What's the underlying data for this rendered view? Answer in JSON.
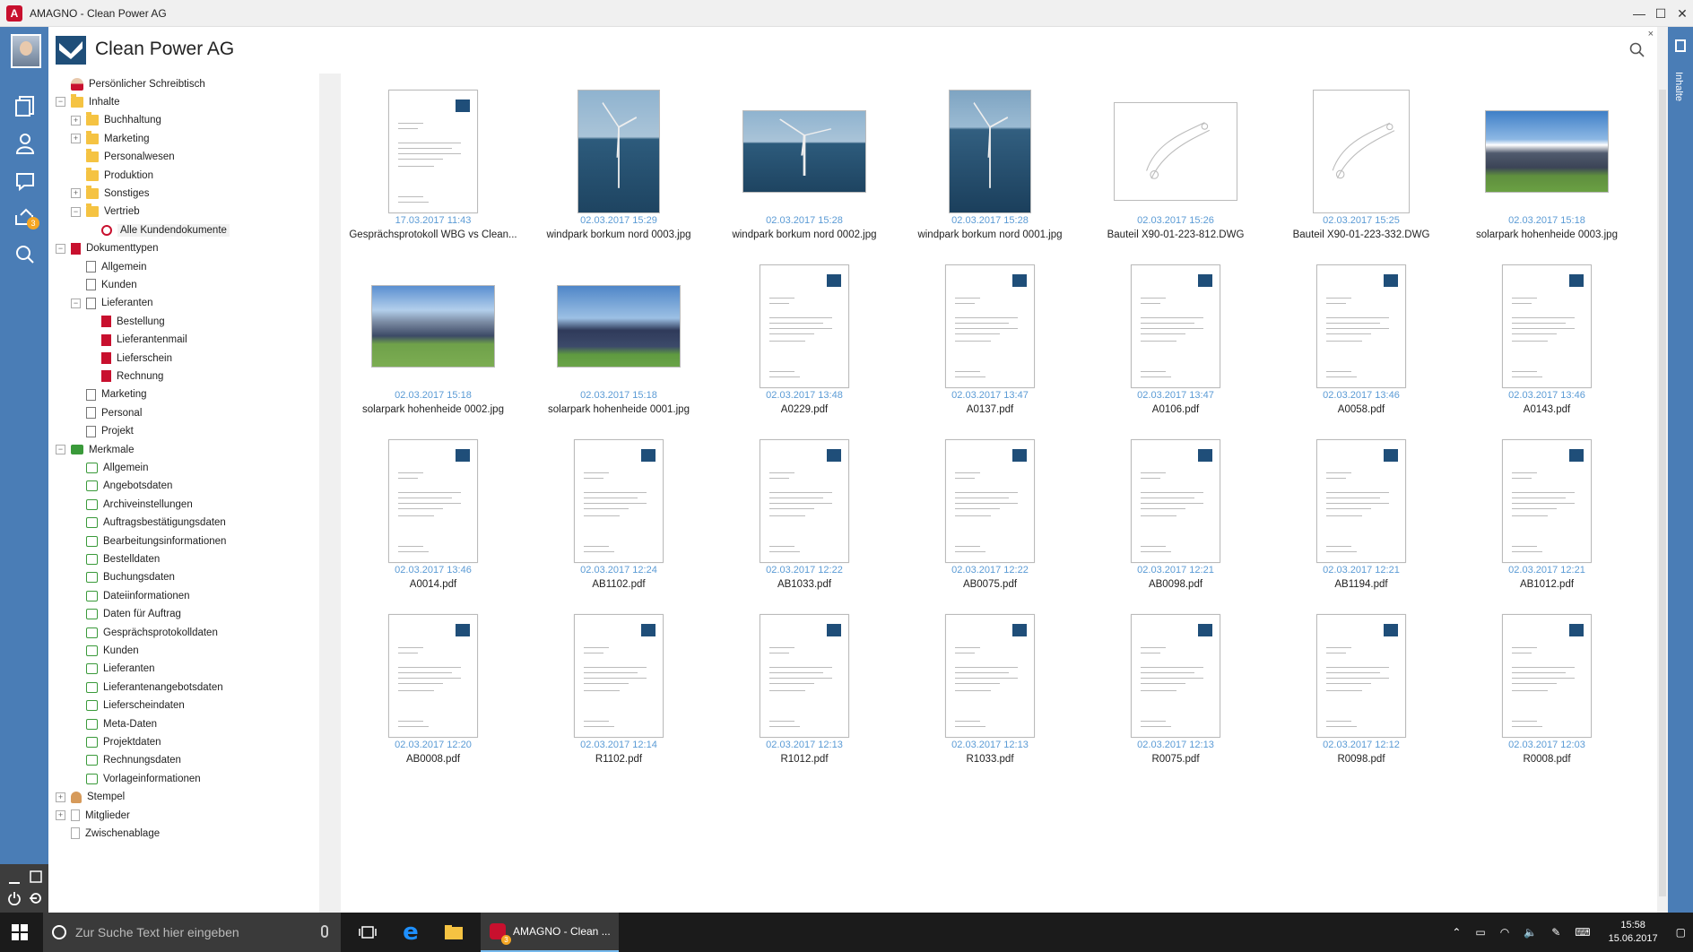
{
  "window": {
    "title": "AMAGNO - Clean Power AG",
    "app_icon_letter": "A"
  },
  "header": {
    "company": "Clean Power AG",
    "close_symbol": "×"
  },
  "rail": {
    "notification_count": "3"
  },
  "right_panel": {
    "label": "Inhalte"
  },
  "tree": [
    {
      "label": "Persönlicher Schreibtisch",
      "icon": "desk-icon",
      "level": 0,
      "exp": ""
    },
    {
      "label": "Inhalte",
      "icon": "folder-icon",
      "level": 0,
      "exp": "−"
    },
    {
      "label": "Buchhaltung",
      "icon": "folder-icon",
      "level": 1,
      "exp": "+"
    },
    {
      "label": "Marketing",
      "icon": "folder-icon",
      "level": 1,
      "exp": "+"
    },
    {
      "label": "Personalwesen",
      "icon": "folder-icon",
      "level": 1,
      "exp": ""
    },
    {
      "label": "Produktion",
      "icon": "folder-icon",
      "level": 1,
      "exp": ""
    },
    {
      "label": "Sonstiges",
      "icon": "folder-icon",
      "level": 1,
      "exp": "+"
    },
    {
      "label": "Vertrieb",
      "icon": "folder-icon",
      "level": 1,
      "exp": "−"
    },
    {
      "label": "Alle Kundendokumente",
      "icon": "saved-search-icon",
      "level": 2,
      "exp": "",
      "selected": true
    },
    {
      "label": "Dokumenttypen",
      "icon": "document-type-red-icon",
      "level": 0,
      "exp": "−"
    },
    {
      "label": "Allgemein",
      "icon": "document-type-icon",
      "level": 1,
      "exp": ""
    },
    {
      "label": "Kunden",
      "icon": "document-type-icon",
      "level": 1,
      "exp": ""
    },
    {
      "label": "Lieferanten",
      "icon": "document-type-icon",
      "level": 1,
      "exp": "−"
    },
    {
      "label": "Bestellung",
      "icon": "document-type-red-icon",
      "level": 2,
      "exp": ""
    },
    {
      "label": "Lieferantenmail",
      "icon": "document-type-red-icon",
      "level": 2,
      "exp": ""
    },
    {
      "label": "Lieferschein",
      "icon": "document-type-red-icon",
      "level": 2,
      "exp": ""
    },
    {
      "label": "Rechnung",
      "icon": "document-type-red-icon",
      "level": 2,
      "exp": ""
    },
    {
      "label": "Marketing",
      "icon": "document-type-icon",
      "level": 1,
      "exp": ""
    },
    {
      "label": "Personal",
      "icon": "document-type-icon",
      "level": 1,
      "exp": ""
    },
    {
      "label": "Projekt",
      "icon": "document-type-icon",
      "level": 1,
      "exp": ""
    },
    {
      "label": "Merkmale",
      "icon": "tag-green-icon",
      "level": 0,
      "exp": "−"
    },
    {
      "label": "Allgemein",
      "icon": "tag-icon",
      "level": 1,
      "exp": ""
    },
    {
      "label": "Angebotsdaten",
      "icon": "tag-icon",
      "level": 1,
      "exp": ""
    },
    {
      "label": "Archiveinstellungen",
      "icon": "tag-icon",
      "level": 1,
      "exp": ""
    },
    {
      "label": "Auftragsbestätigungsdaten",
      "icon": "tag-icon",
      "level": 1,
      "exp": ""
    },
    {
      "label": "Bearbeitungsinformationen",
      "icon": "tag-icon",
      "level": 1,
      "exp": ""
    },
    {
      "label": "Bestelldaten",
      "icon": "tag-icon",
      "level": 1,
      "exp": ""
    },
    {
      "label": "Buchungsdaten",
      "icon": "tag-icon",
      "level": 1,
      "exp": ""
    },
    {
      "label": "Dateiinformationen",
      "icon": "tag-icon",
      "level": 1,
      "exp": ""
    },
    {
      "label": "Daten für Auftrag",
      "icon": "tag-icon",
      "level": 1,
      "exp": ""
    },
    {
      "label": "Gesprächsprotokolldaten",
      "icon": "tag-icon",
      "level": 1,
      "exp": ""
    },
    {
      "label": "Kunden",
      "icon": "tag-icon",
      "level": 1,
      "exp": ""
    },
    {
      "label": "Lieferanten",
      "icon": "tag-icon",
      "level": 1,
      "exp": ""
    },
    {
      "label": "Lieferantenangebotsdaten",
      "icon": "tag-icon",
      "level": 1,
      "exp": ""
    },
    {
      "label": "Lieferscheindaten",
      "icon": "tag-icon",
      "level": 1,
      "exp": ""
    },
    {
      "label": "Meta-Daten",
      "icon": "tag-icon",
      "level": 1,
      "exp": ""
    },
    {
      "label": "Projektdaten",
      "icon": "tag-icon",
      "level": 1,
      "exp": ""
    },
    {
      "label": "Rechnungsdaten",
      "icon": "tag-icon",
      "level": 1,
      "exp": ""
    },
    {
      "label": "Vorlageinformationen",
      "icon": "tag-icon",
      "level": 1,
      "exp": ""
    },
    {
      "label": "Stempel",
      "icon": "stamp-icon",
      "level": 0,
      "exp": "+"
    },
    {
      "label": "Mitglieder",
      "icon": "members-icon",
      "level": 0,
      "exp": "+"
    },
    {
      "label": "Zwischenablage",
      "icon": "clipboard-icon",
      "level": 0,
      "exp": ""
    }
  ],
  "files": [
    {
      "date": "17.03.2017 11:43",
      "name": "Gesprächsprotokoll WBG vs Clean...",
      "kind": "doc"
    },
    {
      "date": "02.03.2017 15:29",
      "name": "windpark borkum nord 0003.jpg",
      "kind": "photo-tall-sea"
    },
    {
      "date": "02.03.2017 15:28",
      "name": "windpark borkum nord 0002.jpg",
      "kind": "photo-sea"
    },
    {
      "date": "02.03.2017 15:28",
      "name": "windpark borkum nord 0001.jpg",
      "kind": "photo-tall-sea2"
    },
    {
      "date": "02.03.2017 15:26",
      "name": "Bauteil X90-01-223-812.DWG",
      "kind": "cad"
    },
    {
      "date": "02.03.2017 15:25",
      "name": "Bauteil X90-01-223-332.DWG",
      "kind": "cad-tall"
    },
    {
      "date": "02.03.2017 15:18",
      "name": "solarpark hohenheide 0003.jpg",
      "kind": "photo-solar"
    },
    {
      "date": "02.03.2017 15:18",
      "name": "solarpark hohenheide 0002.jpg",
      "kind": "photo-solar2"
    },
    {
      "date": "02.03.2017 15:18",
      "name": "solarpark hohenheide 0001.jpg",
      "kind": "photo-solar3"
    },
    {
      "date": "02.03.2017 13:48",
      "name": "A0229.pdf",
      "kind": "doc"
    },
    {
      "date": "02.03.2017 13:47",
      "name": "A0137.pdf",
      "kind": "doc"
    },
    {
      "date": "02.03.2017 13:47",
      "name": "A0106.pdf",
      "kind": "doc"
    },
    {
      "date": "02.03.2017 13:46",
      "name": "A0058.pdf",
      "kind": "doc"
    },
    {
      "date": "02.03.2017 13:46",
      "name": "A0143.pdf",
      "kind": "doc"
    },
    {
      "date": "02.03.2017 13:46",
      "name": "A0014.pdf",
      "kind": "doc"
    },
    {
      "date": "02.03.2017 12:24",
      "name": "AB1102.pdf",
      "kind": "doc"
    },
    {
      "date": "02.03.2017 12:22",
      "name": "AB1033.pdf",
      "kind": "doc"
    },
    {
      "date": "02.03.2017 12:22",
      "name": "AB0075.pdf",
      "kind": "doc"
    },
    {
      "date": "02.03.2017 12:21",
      "name": "AB0098.pdf",
      "kind": "doc"
    },
    {
      "date": "02.03.2017 12:21",
      "name": "AB1194.pdf",
      "kind": "doc"
    },
    {
      "date": "02.03.2017 12:21",
      "name": "AB1012.pdf",
      "kind": "doc"
    },
    {
      "date": "02.03.2017 12:20",
      "name": "AB0008.pdf",
      "kind": "doc"
    },
    {
      "date": "02.03.2017 12:14",
      "name": "R1102.pdf",
      "kind": "doc"
    },
    {
      "date": "02.03.2017 12:13",
      "name": "R1012.pdf",
      "kind": "doc"
    },
    {
      "date": "02.03.2017 12:13",
      "name": "R1033.pdf",
      "kind": "doc"
    },
    {
      "date": "02.03.2017 12:13",
      "name": "R0075.pdf",
      "kind": "doc"
    },
    {
      "date": "02.03.2017 12:12",
      "name": "R0098.pdf",
      "kind": "doc"
    },
    {
      "date": "02.03.2017 12:03",
      "name": "R0008.pdf",
      "kind": "doc"
    }
  ],
  "taskbar": {
    "search_placeholder": "Zur Suche Text hier eingeben",
    "active_app_label": "AMAGNO - Clean ...",
    "time": "15:58",
    "date": "15.06.2017"
  },
  "colors": {
    "accent": "#4a7db6",
    "date_text": "#5b9bd5",
    "brand_red": "#c8102e"
  }
}
